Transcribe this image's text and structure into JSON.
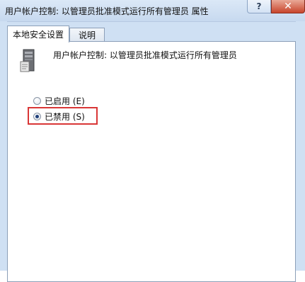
{
  "window": {
    "title": "用户帐户控制: 以管理员批准模式运行所有管理员 属性",
    "help_button": "?",
    "close_button": "✕"
  },
  "tabs": [
    {
      "label": "本地安全设置",
      "active": true
    },
    {
      "label": "说明",
      "active": false
    }
  ],
  "policy": {
    "icon": "server-policy-icon",
    "title": "用户帐户控制: 以管理员批准模式运行所有管理员"
  },
  "options": [
    {
      "label": "已启用 (E)",
      "checked": false
    },
    {
      "label": "已禁用 (S)",
      "checked": true
    }
  ],
  "colors": {
    "highlight": "#d93636",
    "chrome": "#cfe0f3",
    "close": "#c8452c"
  }
}
